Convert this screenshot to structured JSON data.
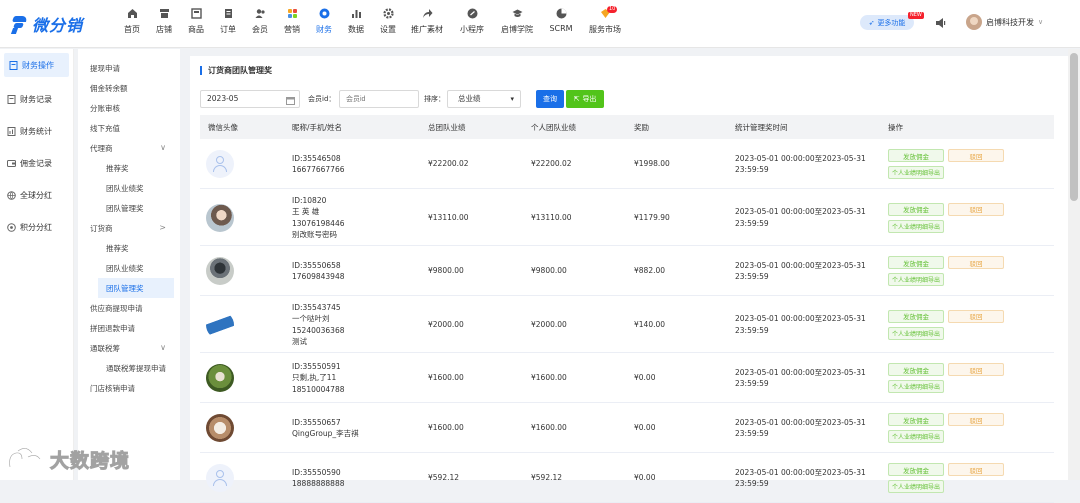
{
  "app": {
    "logo_text": "微分销"
  },
  "nav": [
    {
      "label": "首页",
      "icon": "home-icon"
    },
    {
      "label": "店铺",
      "icon": "store-icon"
    },
    {
      "label": "商品",
      "icon": "goods-icon"
    },
    {
      "label": "订单",
      "icon": "order-icon"
    },
    {
      "label": "会员",
      "icon": "member-icon"
    },
    {
      "label": "营销",
      "icon": "marketing-icon"
    },
    {
      "label": "财务",
      "icon": "finance-icon",
      "active": true
    },
    {
      "label": "数据",
      "icon": "data-icon"
    },
    {
      "label": "设置",
      "icon": "settings-icon"
    },
    {
      "label": "推广素材",
      "icon": "share-icon"
    },
    {
      "label": "小程序",
      "icon": "miniapp-icon"
    },
    {
      "label": "启博学院",
      "icon": "academy-icon"
    },
    {
      "label": "SCRM",
      "icon": "scrm-icon"
    },
    {
      "label": "服务市场",
      "icon": "market-icon"
    }
  ],
  "header": {
    "more_label": "更多功能",
    "new_badge": "NEW",
    "market_badge": "10",
    "user_name": "启博科技开发"
  },
  "side1": [
    {
      "label": "财务操作",
      "active": true
    },
    {
      "label": "财务记录"
    },
    {
      "label": "财务统计"
    },
    {
      "label": "佣金记录"
    },
    {
      "label": "全球分红"
    },
    {
      "label": "积分分红"
    }
  ],
  "side2": [
    {
      "label": "提现申请"
    },
    {
      "label": "佣金转余额"
    },
    {
      "label": "分账审核"
    },
    {
      "label": "线下充值"
    },
    {
      "label": "代理商",
      "chevron": "∨"
    },
    {
      "label": "推荐奖",
      "sub": true
    },
    {
      "label": "团队业绩奖",
      "sub": true
    },
    {
      "label": "团队管理奖",
      "sub": true
    },
    {
      "label": "订货商",
      "chevron": ">"
    },
    {
      "label": "推荐奖",
      "sub": true
    },
    {
      "label": "团队业绩奖",
      "sub": true
    },
    {
      "label": "团队管理奖",
      "sub": true,
      "active": true
    },
    {
      "label": "供应商提现申请"
    },
    {
      "label": "拼团退款申请"
    },
    {
      "label": "通联税筹",
      "chevron": "∨"
    },
    {
      "label": "通联税筹提现申请",
      "sub": true
    },
    {
      "label": "门店核销申请"
    }
  ],
  "panel": {
    "title": "订货商团队管理奖",
    "date_value": "2023-05",
    "member_label": "会员id：",
    "member_placeholder": "会员id",
    "sort_label": "排序：",
    "sort_value": "总业绩",
    "query_label": "查询",
    "export_label": "导出"
  },
  "table": {
    "headers": [
      "微信头像",
      "昵称/手机/姓名",
      "总团队业绩",
      "个人团队业绩",
      "奖励",
      "统计管理奖时间",
      "操作"
    ],
    "pay_label": "发放佣金",
    "reject_label": "驳回",
    "export_label": "个人业绩明细导出",
    "rows": [
      {
        "lines": [
          "ID:35546508",
          "16677667766"
        ],
        "total": "¥22200.02",
        "personal": "¥22200.02",
        "reward": "¥1998.00",
        "time1": "2023-05-01 00:00:00至2023-05-31",
        "time2": "23:59:59",
        "avatar": "default"
      },
      {
        "lines": [
          "ID:10820",
          "王 英 雄",
          "13076198446",
          "别改账号密码"
        ],
        "total": "¥13110.00",
        "personal": "¥13110.00",
        "reward": "¥1179.90",
        "time1": "2023-05-01 00:00:00至2023-05-31",
        "time2": "23:59:59",
        "avatar": "photo-portrait"
      },
      {
        "lines": [
          "ID:35550658",
          "17609843948"
        ],
        "total": "¥9800.00",
        "personal": "¥9800.00",
        "reward": "¥882.00",
        "time1": "2023-05-01 00:00:00至2023-05-31",
        "time2": "23:59:59",
        "avatar": "photo-dark"
      },
      {
        "lines": [
          "ID:35543745",
          "一个哒叶刘",
          "15240036368",
          "测试"
        ],
        "total": "¥2000.00",
        "personal": "¥2000.00",
        "reward": "¥140.00",
        "time1": "2023-05-01 00:00:00至2023-05-31",
        "time2": "23:59:59",
        "avatar": "photo-figure"
      },
      {
        "lines": [
          "ID:35550591",
          "只剩,执,了11",
          "18510004788"
        ],
        "total": "¥1600.00",
        "personal": "¥1600.00",
        "reward": "¥0.00",
        "time1": "2023-05-01 00:00:00至2023-05-31",
        "time2": "23:59:59",
        "avatar": "photo-green"
      },
      {
        "lines": [
          "ID:35550657",
          "QingGroup_李吉祺"
        ],
        "total": "¥1600.00",
        "personal": "¥1600.00",
        "reward": "¥0.00",
        "time1": "2023-05-01 00:00:00至2023-05-31",
        "time2": "23:59:59",
        "avatar": "photo-dog"
      },
      {
        "lines": [
          "ID:35550590",
          "18888888888"
        ],
        "total": "¥592.12",
        "personal": "¥592.12",
        "reward": "¥0.00",
        "time1": "2023-05-01 00:00:00至2023-05-31",
        "time2": "23:59:59",
        "avatar": "default"
      }
    ]
  },
  "watermark": {
    "text": "大数跨境"
  }
}
